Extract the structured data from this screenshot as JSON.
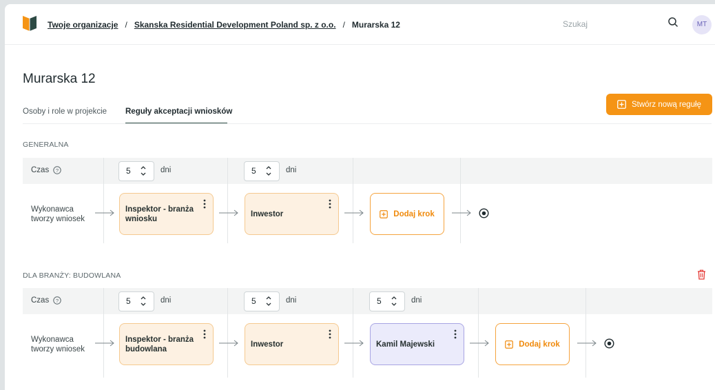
{
  "breadcrumb": {
    "org_link": "Twoje organizacje",
    "company_link": "Skanska Residential Development Poland sp. z o.o.",
    "current": "Murarska 12",
    "separator": "/"
  },
  "search": {
    "placeholder": "Szukaj"
  },
  "user": {
    "initials": "MT"
  },
  "page": {
    "title": "Murarska 12"
  },
  "tabs": [
    {
      "label": "Osoby i role w projekcie",
      "active": false
    },
    {
      "label": "Reguły akceptacji wniosków",
      "active": true
    }
  ],
  "create_button": {
    "label": "Stwórz nową regułę"
  },
  "colors": {
    "accent": "#f59415",
    "step_peach": "#fdf1e2",
    "step_lilac": "#ebebfb",
    "delete_red": "#e53935"
  },
  "common": {
    "time_label": "Czas",
    "days_unit": "dni",
    "add_step_label": "Dodaj krok",
    "start_text": "Wykonawca tworzy wniosek"
  },
  "rules": [
    {
      "label": "GENERALNA",
      "deletable": false,
      "days": [
        5,
        5
      ],
      "steps": [
        {
          "label": "Inspektor - branża wniosku",
          "style": "peach"
        },
        {
          "label": "Inwestor",
          "style": "peach"
        }
      ]
    },
    {
      "label": "DLA BRANŻY: BUDOWLANA",
      "deletable": true,
      "days": [
        5,
        5,
        5
      ],
      "steps": [
        {
          "label": "Inspektor - branża budowlana",
          "style": "peach"
        },
        {
          "label": "Inwestor",
          "style": "peach"
        },
        {
          "label": "Kamil Majewski",
          "style": "lilac"
        }
      ]
    }
  ],
  "icons": [
    "logo-icon",
    "search-icon",
    "plus-square-icon",
    "help-circle-icon",
    "chevron-updown-icon",
    "kebab-menu-icon",
    "arrow-right-icon",
    "end-stop-icon",
    "trash-icon"
  ]
}
